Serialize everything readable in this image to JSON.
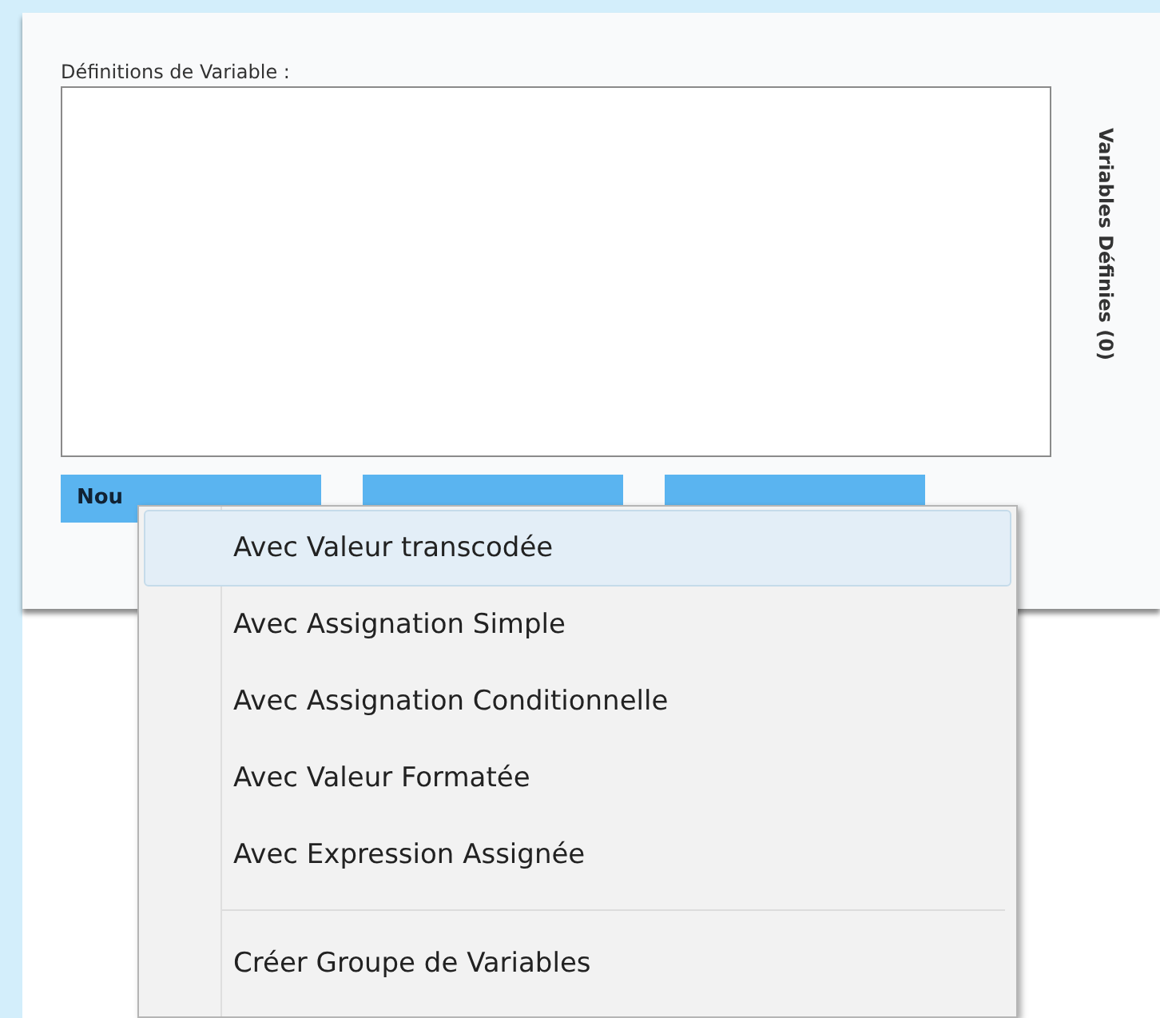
{
  "definitions_label": "Définitions de Variable :",
  "side_tab": {
    "label": "Variables Définies (0)"
  },
  "buttons": [
    {
      "kind": "labeled",
      "label": "Nou"
    },
    {
      "kind": "blank"
    },
    {
      "kind": "blank"
    }
  ],
  "menu": {
    "items": [
      {
        "label": "Avec Valeur transcodée",
        "selected": true,
        "separator_before": false
      },
      {
        "label": "Avec Assignation Simple",
        "selected": false,
        "separator_before": false
      },
      {
        "label": "Avec Assignation Conditionnelle",
        "selected": false,
        "separator_before": false
      },
      {
        "label": "Avec Valeur Formatée",
        "selected": false,
        "separator_before": false
      },
      {
        "label": "Avec Expression Assignée",
        "selected": false,
        "separator_before": false
      },
      {
        "label": "Créer Groupe de Variables",
        "selected": false,
        "separator_before": true
      }
    ]
  }
}
